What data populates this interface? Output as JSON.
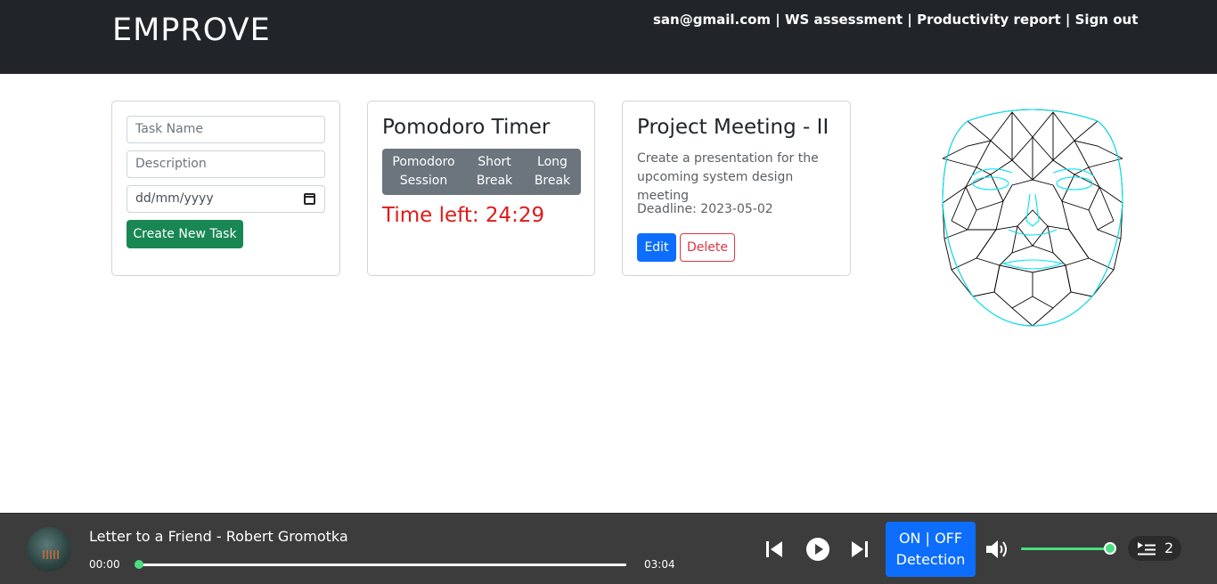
{
  "navbar": {
    "brand": "EMPROVE",
    "email": "san@gmail.com",
    "links": [
      " | WS assessment",
      " | Productivity report",
      " | Sign out"
    ]
  },
  "task_form": {
    "task_name_placeholder": "Task Name",
    "description_placeholder": "Description",
    "date_placeholder": "dd/mm/yyyy",
    "create_button": "Create New Task"
  },
  "pomodoro": {
    "title": "Pomodoro Timer",
    "modes": [
      "Pomodoro\nSession",
      "Short\nBreak",
      "Long\nBreak"
    ],
    "time_left": "Time left: 24:29"
  },
  "task_card": {
    "title": "Project Meeting - II",
    "description": "Create a presentation for the upcoming system design meeting",
    "deadline": "Deadline: 2023-05-02",
    "edit_label": "Edit",
    "delete_label": "Delete"
  },
  "player": {
    "track_title": "Letter to a Friend - Robert Gromotka",
    "current_time": "00:00",
    "total_time": "03:04",
    "progress": 0.0,
    "volume": 1.0,
    "detection_label_line1": "ON | OFF",
    "detection_label_line2": "Detection",
    "queue_count": "2"
  },
  "colors": {
    "navbar_bg": "#212529",
    "success": "#198754",
    "primary": "#0d6efd",
    "danger": "#dc3545",
    "timer_red": "#e11919",
    "player_bg": "#3c3c3c",
    "slider_green": "#4ade80",
    "mesh_cyan": "#00e5ee"
  },
  "icons": {
    "calendar": "calendar-icon",
    "prev": "skip-previous-icon",
    "play": "play-icon",
    "next": "skip-next-icon",
    "volume": "volume-icon",
    "queue": "queue-list-icon"
  }
}
